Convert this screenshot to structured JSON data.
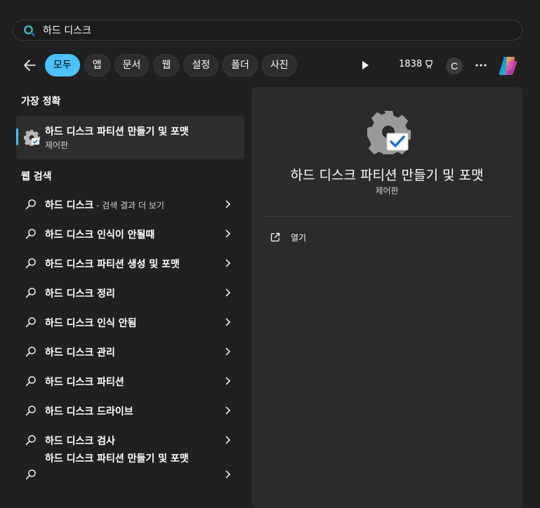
{
  "search": {
    "query": "하드 디스크"
  },
  "tabs": [
    {
      "label": "모두",
      "active": true
    },
    {
      "label": "앱"
    },
    {
      "label": "문서"
    },
    {
      "label": "웹"
    },
    {
      "label": "설정"
    },
    {
      "label": "폴더"
    },
    {
      "label": "사진"
    }
  ],
  "toolbar": {
    "points": "1838",
    "avatar_letter": "C"
  },
  "best_match": {
    "heading": "가장 정확",
    "title": "하드 디스크 파티션 만들기 및 포맷",
    "subtitle": "제어판"
  },
  "web": {
    "heading": "웹 검색",
    "items": [
      {
        "label": "하드 디스크",
        "hint": " - 검색 결과 더 보기"
      },
      {
        "label": "하드 디스크 인식이 안될때"
      },
      {
        "label": "하드 디스크 파티션 생성 및 포맷"
      },
      {
        "label": "하드 디스크 정리"
      },
      {
        "label": "하드 디스크 인식 안됨"
      },
      {
        "label": "하드 디스크 관리"
      },
      {
        "label": "하드 디스크 파티션"
      },
      {
        "label": "하드 디스크 드라이브"
      },
      {
        "label": "하드 디스크 검사"
      },
      {
        "label": "하드 디스크 파티션 만들기 및 포맷"
      }
    ]
  },
  "detail": {
    "title": "하드 디스크 파티션 만들기 및 포맷",
    "subtitle": "제어판",
    "open_label": "열기"
  },
  "colors": {
    "accent": "#4cc2ff",
    "background": "#202020",
    "panel": "#2b2b2b"
  },
  "icons": [
    "search-icon",
    "back-arrow-icon",
    "play-icon",
    "trophy-icon",
    "more-icon",
    "copilot-icon",
    "control-panel-icon",
    "chevron-right-icon",
    "open-external-icon"
  ]
}
